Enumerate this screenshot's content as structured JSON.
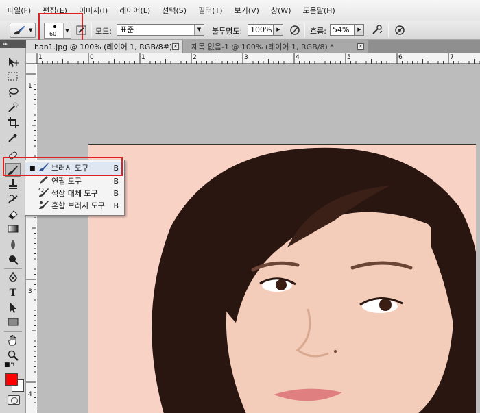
{
  "menubar": {
    "items": [
      "파일(F)",
      "편집(E)",
      "이미지(I)",
      "레이어(L)",
      "선택(S)",
      "필터(T)",
      "보기(V)",
      "창(W)",
      "도움말(H)"
    ]
  },
  "options": {
    "brush_size": "60",
    "mode_label": "모드:",
    "mode_value": "표준",
    "opacity_label": "불투명도:",
    "opacity_value": "100%",
    "flow_label": "흐름:",
    "flow_value": "54%"
  },
  "tabs": [
    {
      "title": "han1.jpg @ 100% (레이어 1, RGB/8#) *",
      "active": true
    },
    {
      "title": "제목 없음-1 @ 100% (레이어 1, RGB/8) *",
      "active": false
    }
  ],
  "ruler": {
    "top": [
      "1",
      "0",
      "1",
      "2",
      "3",
      "4",
      "5",
      "6",
      "7"
    ],
    "left": [
      "1",
      "2",
      "3",
      "4"
    ]
  },
  "flyout": {
    "items": [
      {
        "label": "브러시 도구",
        "key": "B",
        "selected": true,
        "icon": "brush-icon"
      },
      {
        "label": "연필 도구",
        "key": "B",
        "selected": false,
        "icon": "pencil-icon"
      },
      {
        "label": "색상 대체 도구",
        "key": "B",
        "selected": false,
        "icon": "color-replacement-icon"
      },
      {
        "label": "혼합 브러시 도구",
        "key": "B",
        "selected": false,
        "icon": "mixer-brush-icon"
      }
    ]
  },
  "colors": {
    "foreground": "#ff0000",
    "background": "#ffffff",
    "highlight_frame": "#e02020",
    "photo_background": "#f9d2c6"
  }
}
